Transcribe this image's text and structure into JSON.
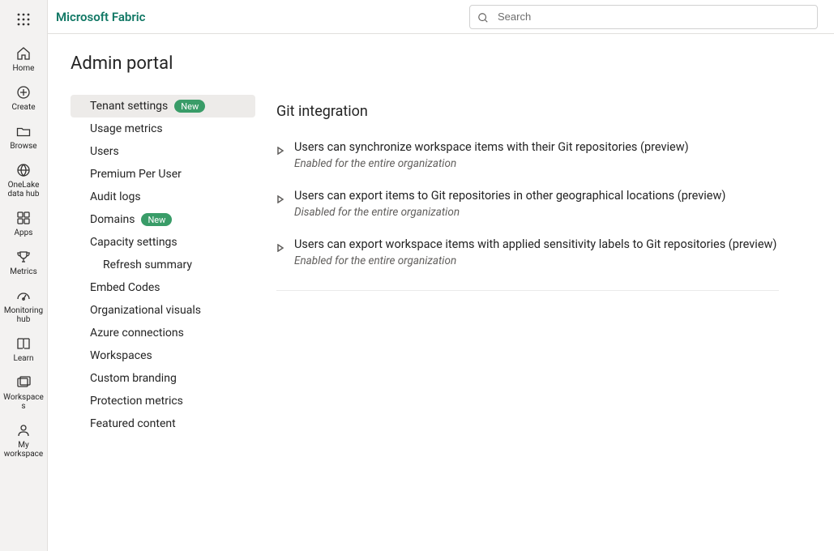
{
  "brand": "Microsoft Fabric",
  "search": {
    "placeholder": "Search"
  },
  "global_nav": {
    "home": "Home",
    "create": "Create",
    "browse": "Browse",
    "onelake": "OneLake data hub",
    "apps": "Apps",
    "metrics": "Metrics",
    "monitoring": "Monitoring hub",
    "learn": "Learn",
    "workspaces": "Workspaces",
    "my_workspace": "My workspace"
  },
  "page": {
    "title": "Admin portal",
    "badge_new": "New",
    "nav": {
      "tenant_settings": "Tenant settings",
      "usage_metrics": "Usage metrics",
      "users": "Users",
      "premium_per_user": "Premium Per User",
      "audit_logs": "Audit logs",
      "domains": "Domains",
      "capacity_settings": "Capacity settings",
      "refresh_summary": "Refresh summary",
      "embed_codes": "Embed Codes",
      "org_visuals": "Organizational visuals",
      "azure_connections": "Azure connections",
      "workspaces": "Workspaces",
      "custom_branding": "Custom branding",
      "protection_metrics": "Protection metrics",
      "featured_content": "Featured content"
    },
    "section_title": "Git integration",
    "settings": {
      "sync": {
        "title": "Users can synchronize workspace items with their Git repositories (preview)",
        "status": "Enabled for the entire organization"
      },
      "export_geo": {
        "title": "Users can export items to Git repositories in other geographical locations (preview)",
        "status": "Disabled for the entire organization"
      },
      "export_sensitivity": {
        "title": "Users can export workspace items with applied sensitivity labels to Git repositories (preview)",
        "status": "Enabled for the entire organization"
      }
    }
  }
}
